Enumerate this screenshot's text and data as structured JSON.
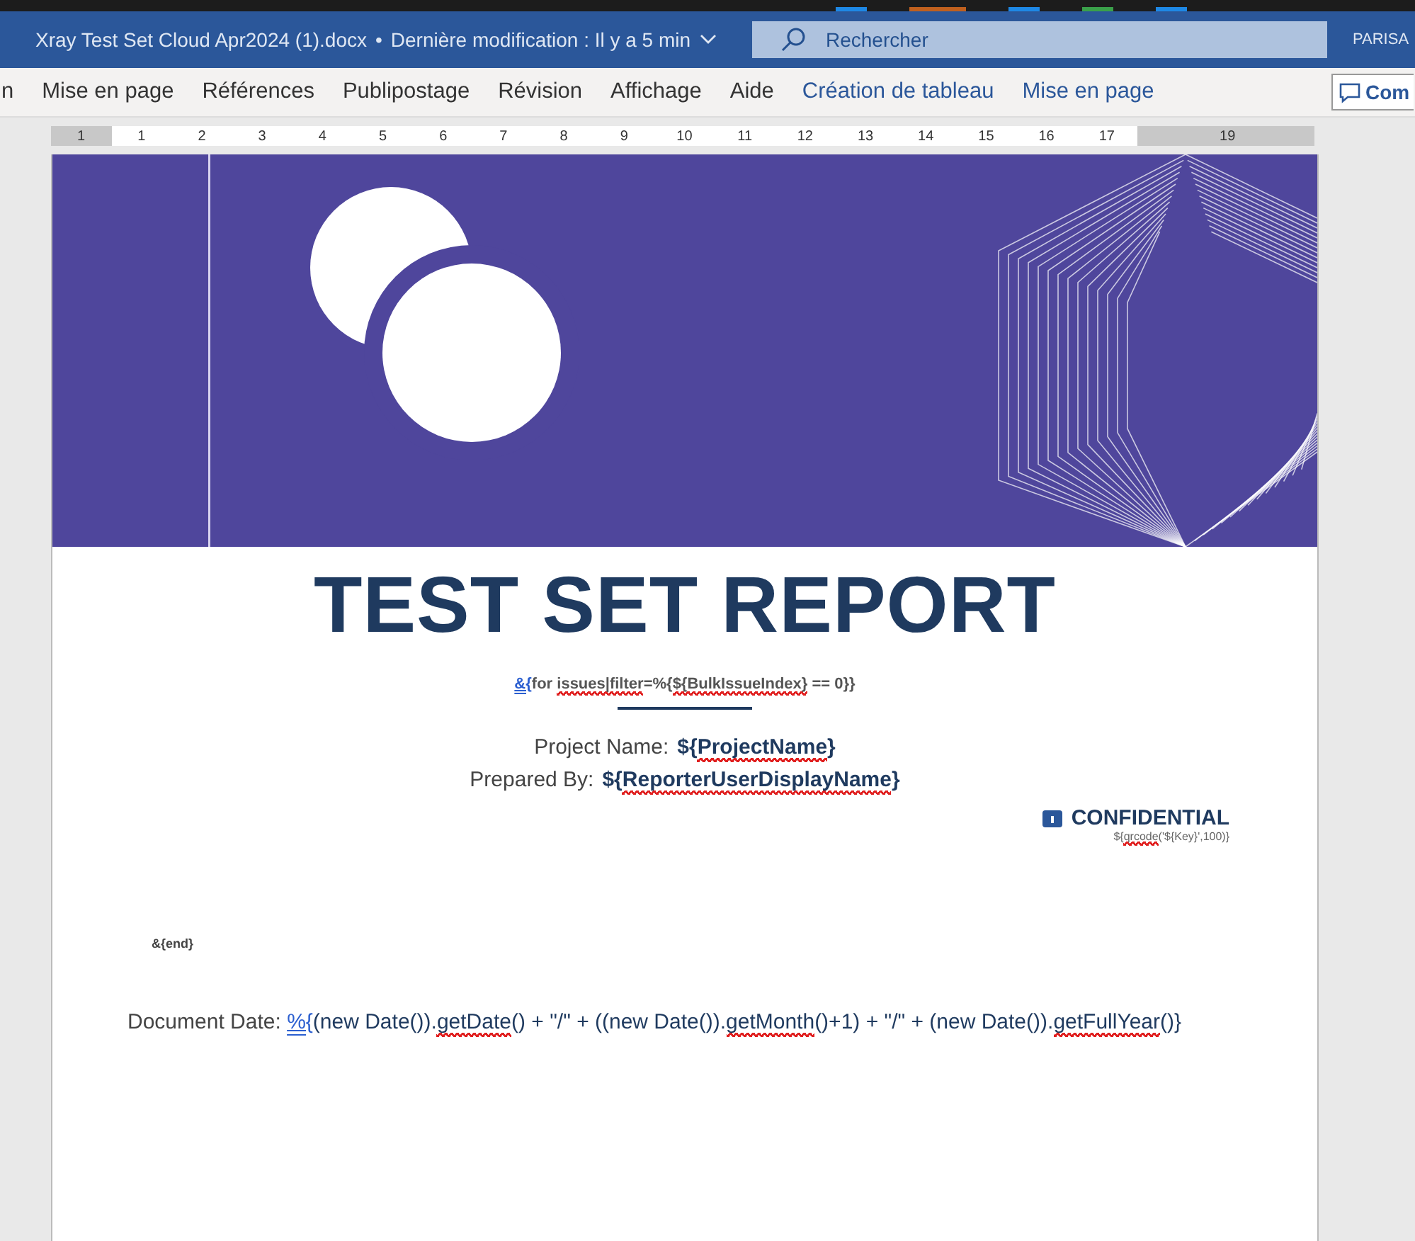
{
  "title_bar": {
    "document": "Xray Test Set Cloud Apr2024 (1).docx",
    "separator": "•",
    "status": "Dernière modification : Il y a 5 min",
    "search": {
      "placeholder": "Rechercher"
    },
    "user": "PARISA"
  },
  "ribbon": {
    "tabs": [
      {
        "label": "n",
        "kind": "normal",
        "selected": false
      },
      {
        "label": "Mise en page",
        "kind": "normal",
        "selected": false
      },
      {
        "label": "Références",
        "kind": "normal",
        "selected": false
      },
      {
        "label": "Publipostage",
        "kind": "normal",
        "selected": false
      },
      {
        "label": "Révision",
        "kind": "normal",
        "selected": false
      },
      {
        "label": "Affichage",
        "kind": "normal",
        "selected": false
      },
      {
        "label": "Aide",
        "kind": "normal",
        "selected": false
      },
      {
        "label": "Création de tableau",
        "kind": "contextual",
        "selected": false
      },
      {
        "label": "Mise en page",
        "kind": "contextual",
        "selected": false
      }
    ],
    "comment_button": "Com"
  },
  "ruler": [
    {
      "label": "1",
      "margin": true
    },
    {
      "label": "1",
      "margin": false
    },
    {
      "label": "2",
      "margin": false
    },
    {
      "label": "3",
      "margin": false
    },
    {
      "label": "4",
      "margin": false
    },
    {
      "label": "5",
      "margin": false
    },
    {
      "label": "6",
      "margin": false
    },
    {
      "label": "7",
      "margin": false
    },
    {
      "label": "8",
      "margin": false
    },
    {
      "label": "9",
      "margin": false
    },
    {
      "label": "10",
      "margin": false
    },
    {
      "label": "11",
      "margin": false
    },
    {
      "label": "12",
      "margin": false
    },
    {
      "label": "13",
      "margin": false
    },
    {
      "label": "14",
      "margin": false
    },
    {
      "label": "15",
      "margin": false
    },
    {
      "label": "16",
      "margin": false
    },
    {
      "label": "17",
      "margin": false
    },
    {
      "label": "19",
      "margin": true
    }
  ],
  "document": {
    "title": "TEST SET REPORT",
    "loop_start": [
      {
        "text": "&{",
        "link": true,
        "misspelled": false
      },
      {
        "text": "for ",
        "link": false,
        "misspelled": false
      },
      {
        "text": "issues|filter",
        "link": false,
        "misspelled": true
      },
      {
        "text": "=%{",
        "link": false,
        "misspelled": false
      },
      {
        "text": "${BulkIssueIndex}",
        "link": false,
        "misspelled": true
      },
      {
        "text": " == 0}}",
        "link": false,
        "misspelled": false
      }
    ],
    "fields": [
      {
        "label": "Project Name:",
        "value": [
          {
            "text": "${",
            "link": false,
            "misspelled": false
          },
          {
            "text": "ProjectName",
            "link": false,
            "misspelled": true
          },
          {
            "text": "}",
            "link": false,
            "misspelled": false
          }
        ]
      },
      {
        "label": "Prepared By:",
        "value": [
          {
            "text": "${",
            "link": false,
            "misspelled": false
          },
          {
            "text": "ReporterUserDisplayName",
            "link": false,
            "misspelled": true
          },
          {
            "text": "}",
            "link": false,
            "misspelled": false
          }
        ]
      }
    ],
    "classification": "CONFIDENTIAL",
    "qr_code": [
      {
        "text": "${",
        "link": false,
        "misspelled": false
      },
      {
        "text": "qrcode",
        "link": false,
        "misspelled": true
      },
      {
        "text": "('${Key}',100)}",
        "link": false,
        "misspelled": false
      }
    ],
    "loop_end": "&{end}",
    "date": {
      "label": "Document Date:",
      "value": [
        {
          "text": "%{",
          "link": true,
          "misspelled": false
        },
        {
          "text": "(new Date()).",
          "link": false,
          "misspelled": false
        },
        {
          "text": "getDate",
          "link": false,
          "misspelled": true
        },
        {
          "text": "() + \"/\" + ((new Date()).",
          "link": false,
          "misspelled": false
        },
        {
          "text": "getMonth",
          "link": false,
          "misspelled": true
        },
        {
          "text": "()+1) + \"/\" + (new Date()).",
          "link": false,
          "misspelled": false
        },
        {
          "text": "getFullYear",
          "link": false,
          "misspelled": true
        },
        {
          "text": "()}",
          "link": false,
          "misspelled": false
        }
      ]
    }
  }
}
